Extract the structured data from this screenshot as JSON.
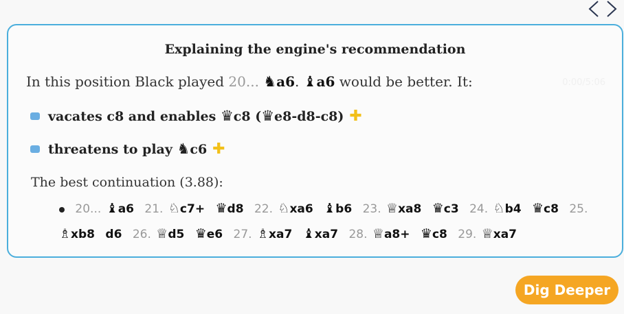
{
  "title": "Explaining the engine's recommendation",
  "intro": {
    "prefix": "In this position Black played",
    "played_num": "20...",
    "played_piece": "♞",
    "played_sq": "a6",
    "best_piece": "♝",
    "best_sq": "a6",
    "suffix": "would be better. It:"
  },
  "watermark": "0:00/5:06",
  "bullets": [
    {
      "text1": "vacates c8 and enables",
      "p1": "♛",
      "t2": "c8",
      "p2": "♛",
      "t3": "e8-d8-c8)"
    },
    {
      "text1": "threatens to play",
      "p1": "♞",
      "t2": "c6"
    }
  ],
  "plus_symbol": "✚",
  "best_continuation": "The best continuation (3.88):",
  "moves": [
    {
      "num": "20...",
      "piece": "♝",
      "move": "a6"
    },
    {
      "num": "21.",
      "piece": "♘",
      "move": "c7+"
    },
    {
      "num": "",
      "piece": "♛",
      "move": "d8"
    },
    {
      "num": "22.",
      "piece": "♘",
      "move": "xa6"
    },
    {
      "num": "",
      "piece": "♝",
      "move": "b6"
    },
    {
      "num": "23.",
      "piece": "♕",
      "move": "xa8"
    },
    {
      "num": "",
      "piece": "♛",
      "move": "c3"
    },
    {
      "num": "24.",
      "piece": "♘",
      "move": "b4"
    },
    {
      "num": "",
      "piece": "♛",
      "move": "c8"
    },
    {
      "num": "25.",
      "piece": "♗",
      "move": "xb8"
    },
    {
      "num": "",
      "piece": "",
      "move": "d6"
    },
    {
      "num": "26.",
      "piece": "♕",
      "move": "d5"
    },
    {
      "num": "",
      "piece": "♛",
      "move": "e6"
    },
    {
      "num": "27.",
      "piece": "♗",
      "move": "xa7"
    },
    {
      "num": "",
      "piece": "♝",
      "move": "xa7"
    },
    {
      "num": "28.",
      "piece": "♕",
      "move": "a8+"
    },
    {
      "num": "",
      "piece": "♛",
      "move": "c8"
    },
    {
      "num": "29.",
      "piece": "♕",
      "move": "xa7"
    }
  ],
  "dig_button": "Dig Deeper",
  "colors": {
    "border": "#4aaedc",
    "bullet": "#6aaee2",
    "plus": "#f2c01a",
    "button": "#f5a623"
  }
}
